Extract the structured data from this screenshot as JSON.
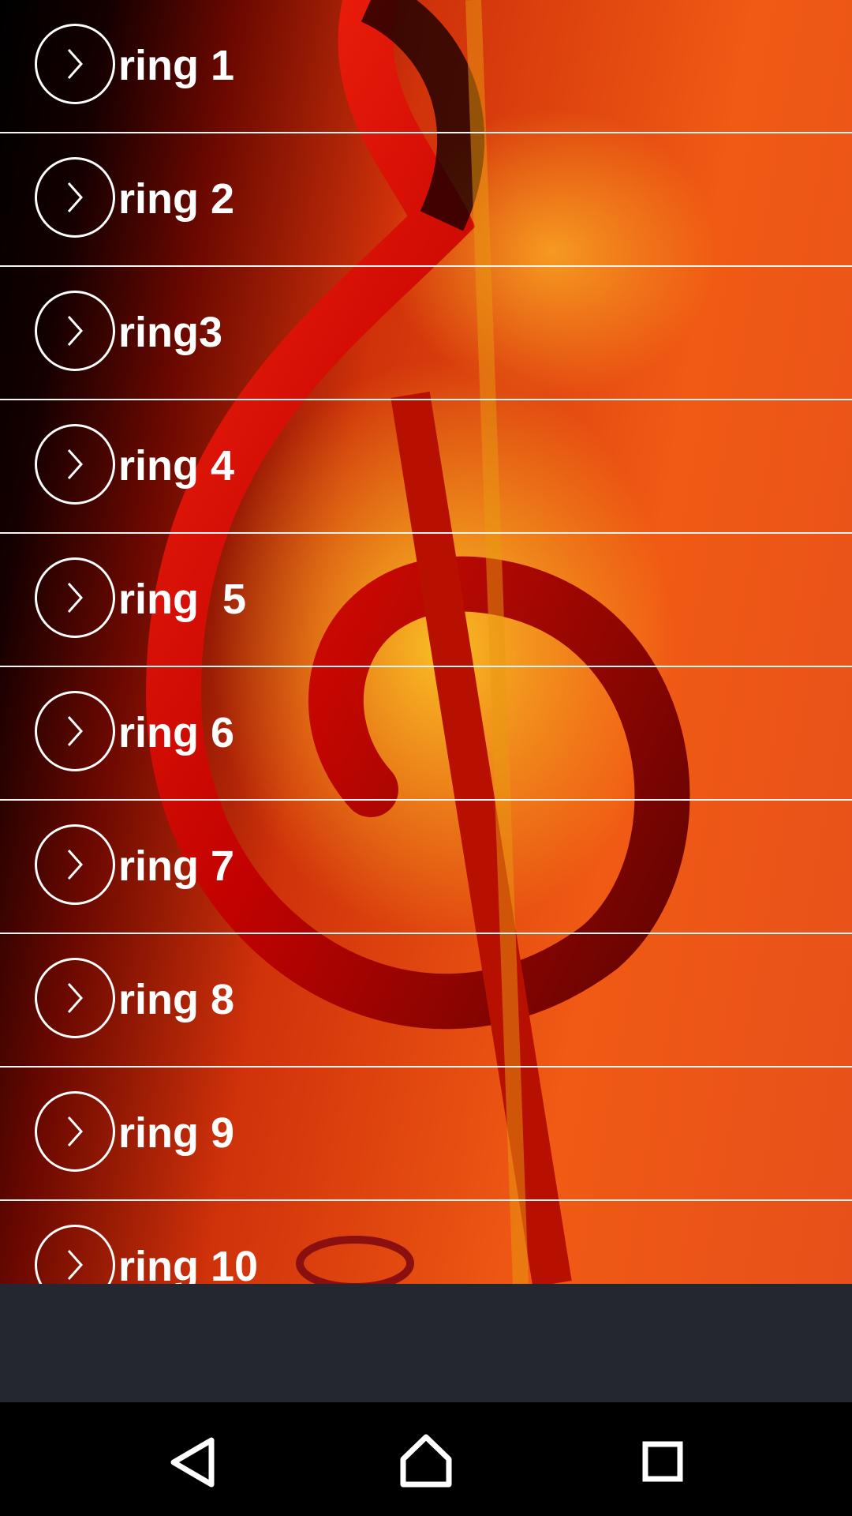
{
  "ringtones": [
    {
      "label": "ring 1"
    },
    {
      "label": "ring 2"
    },
    {
      "label": "ring3"
    },
    {
      "label": "ring 4"
    },
    {
      "label": "ring  5"
    },
    {
      "label": "ring 6"
    },
    {
      "label": "ring 7"
    },
    {
      "label": "ring 8"
    },
    {
      "label": "ring 9"
    },
    {
      "label": "ring 10"
    }
  ],
  "icons": {
    "row": "chevron-right-circle-icon",
    "back": "back-triangle-icon",
    "home": "home-icon",
    "recents": "recents-square-icon"
  },
  "colors": {
    "divider": "#f4f4f4",
    "label": "#ffffff",
    "ad_bar": "#24272f",
    "nav_bar": "#000000"
  }
}
